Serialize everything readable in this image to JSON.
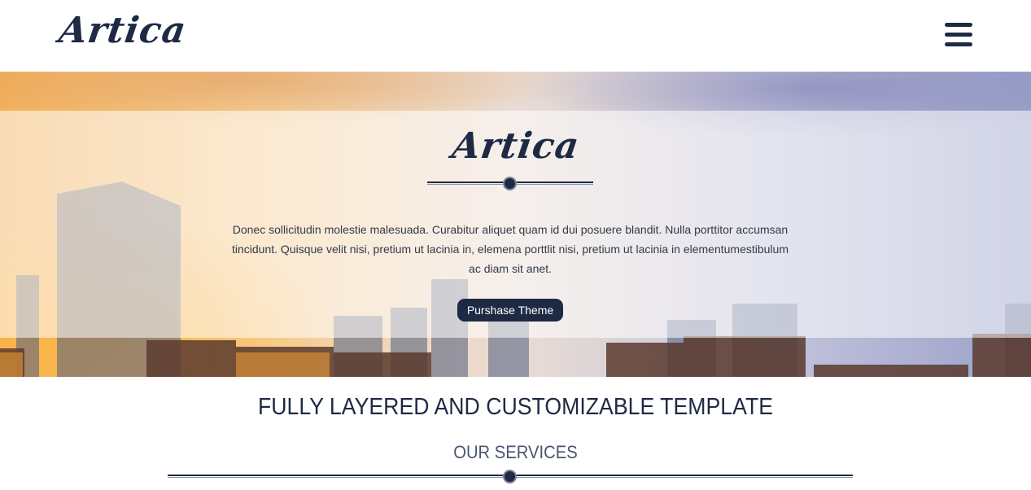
{
  "header": {
    "logo_text": "Artica",
    "menu_icon": "hamburger-menu-icon"
  },
  "hero": {
    "logo_text": "Artica",
    "description": "Donec sollicitudin molestie malesuada. Curabitur aliquet quam id dui posuere blandit. Nulla porttitor accumsan tincidunt. Quisque velit nisi, pretium ut lacinia in, elemena porttlit nisi, pretium ut lacinia in elementumestibulum ac diam sit anet.",
    "button_label": "Purshase Theme"
  },
  "intro": {
    "heading": "FULLY LAYERED AND CUSTOMIZABLE TEMPLATE"
  },
  "services": {
    "heading": "OUR SERVICES"
  },
  "colors": {
    "primary": "#1e2a44",
    "text": "#333a48",
    "background": "#ffffff"
  }
}
